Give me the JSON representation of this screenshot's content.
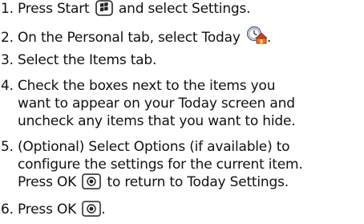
{
  "steps": [
    {
      "number": "1.",
      "text_before": "Press Start",
      "icon": "windows-start-key-icon",
      "text_after": "and select Settings."
    },
    {
      "number": "2.",
      "text_before": "On the Personal tab, select Today",
      "icon": "today-settings-icon",
      "text_after": "."
    },
    {
      "number": "3.",
      "text": "Select the Items tab."
    },
    {
      "number": "4.",
      "lines": [
        "Check the boxes next to the items you",
        "want to appear on your Today screen and",
        "uncheck any items that you want to hide."
      ]
    },
    {
      "number": "5.",
      "lines": [
        "(Optional) Select Options (if available) to",
        "configure the settings for the current item."
      ],
      "last_before": "Press OK",
      "icon": "ok-key-icon",
      "last_after": "to return to Today Settings."
    },
    {
      "number": "6.",
      "text_before": "Press OK",
      "icon": "ok-key-icon",
      "text_after": "."
    }
  ]
}
